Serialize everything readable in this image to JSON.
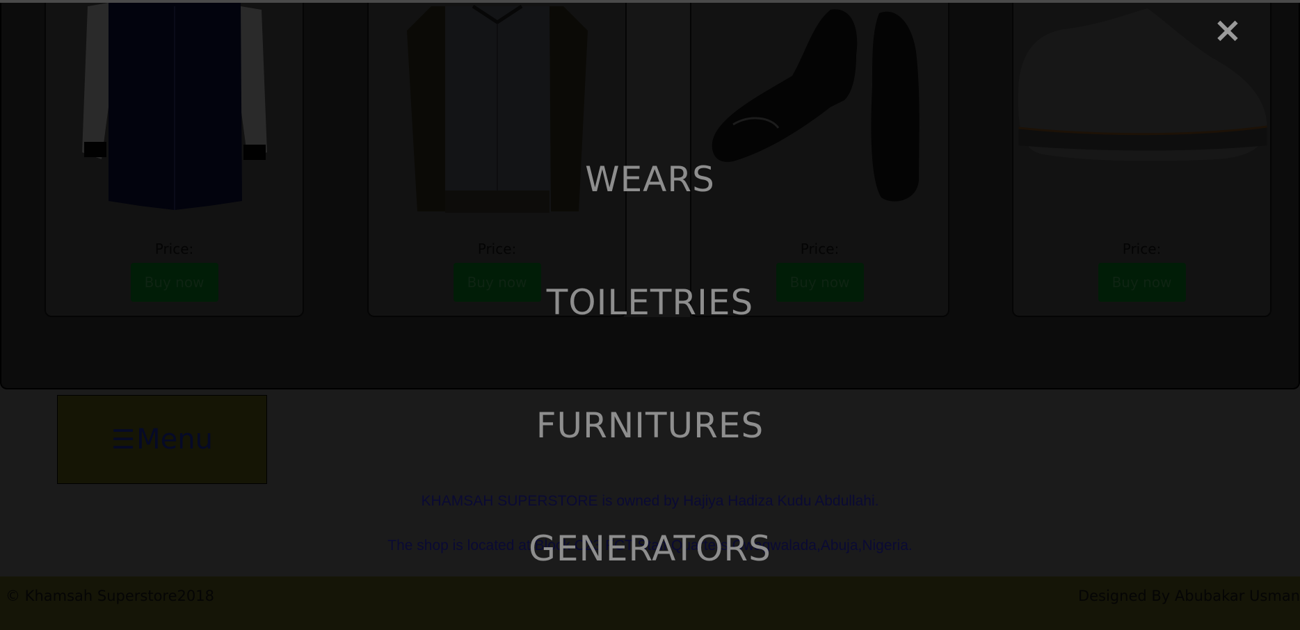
{
  "products": [
    {
      "name": "dark-patterned-shirt",
      "price_label": "Price:",
      "button_label": "Buy now"
    },
    {
      "name": "white-floral-sleeve-shirt",
      "price_label": "Price:",
      "button_label": "Buy now"
    },
    {
      "name": "black-patent-oxford-shoes",
      "price_label": "Price:",
      "button_label": "Buy now"
    },
    {
      "name": "suede-lace-up-shoe",
      "price_label": "Price:",
      "button_label": "Buy now"
    }
  ],
  "menu": {
    "icon": "☰",
    "label": "Menu"
  },
  "info": {
    "owner_line": "KHAMSAH SUPERSTORE is owned by Hajiya Hadiza Kudu Abdullahi.",
    "location_line": "The shop is located at Block C23 FCT Staff Quarters,Gwagwalada,Abuja,Nigeria."
  },
  "footer": {
    "copyright": "© Khamsah Superstore2018",
    "designer": "Designed By Abubakar Usman"
  },
  "overlay": {
    "close_label": "×",
    "links": [
      "WEARS",
      "TOILETRIES",
      "FURNITURES",
      "GENERATORS"
    ]
  },
  "colors": {
    "overlay_text": "#8e8e8e",
    "menu_bg": "#151505",
    "footer_bg": "#151507",
    "button_bg": "#011d07"
  }
}
